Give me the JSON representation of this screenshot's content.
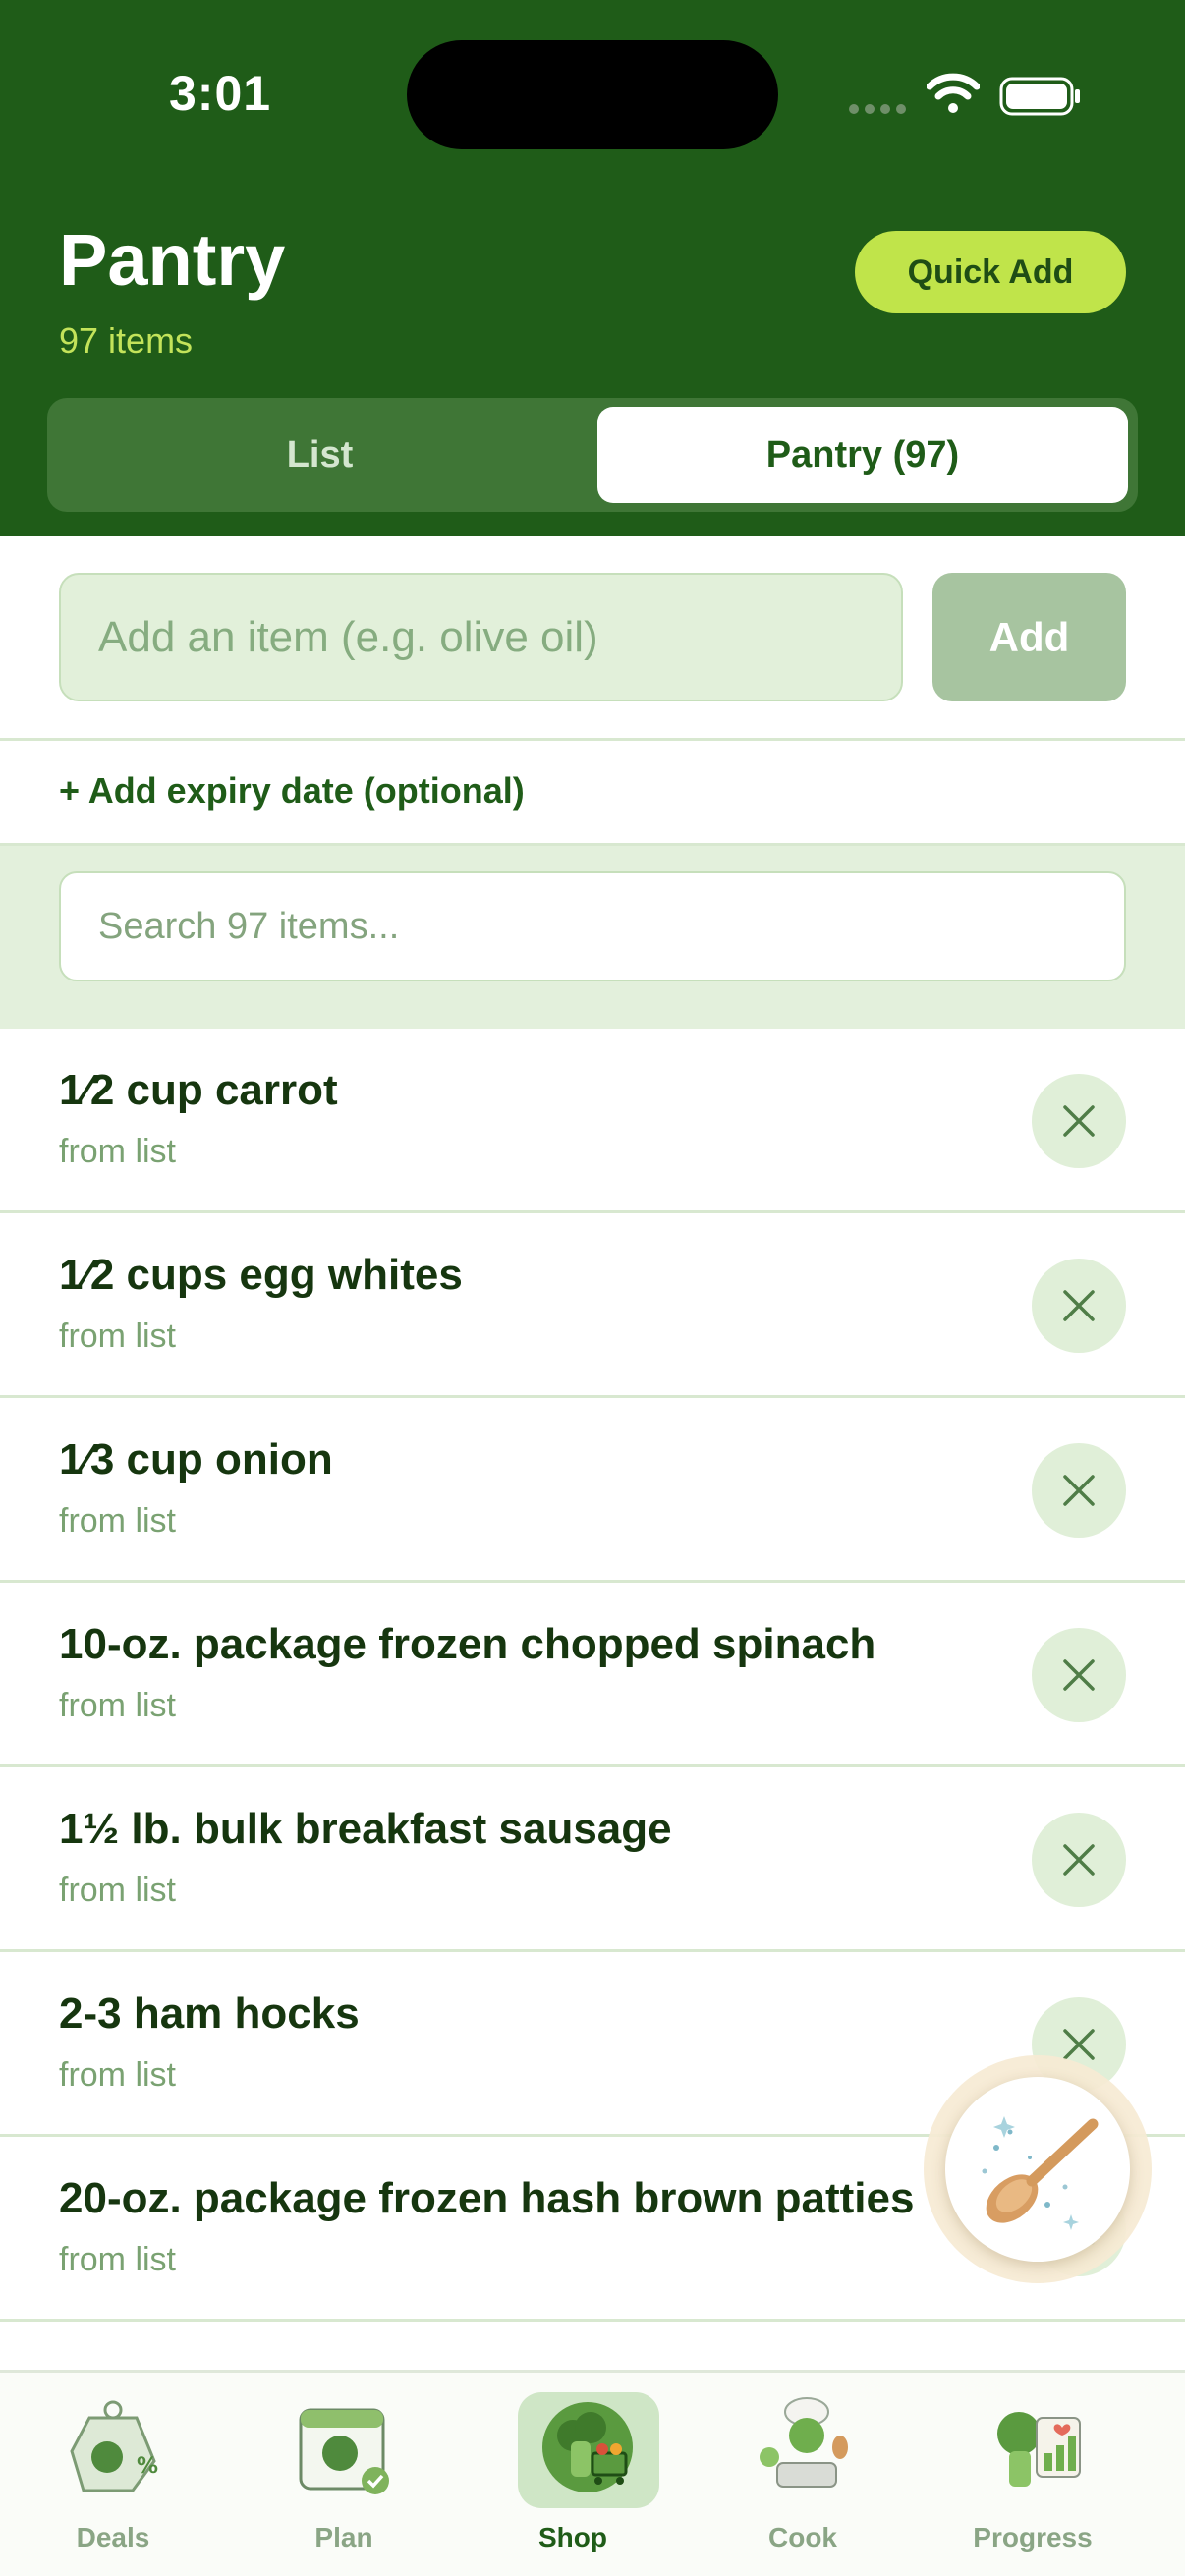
{
  "status_bar": {
    "time": "3:01"
  },
  "header": {
    "title": "Pantry",
    "count_label": "97 items",
    "quick_add_label": "Quick Add"
  },
  "segments": {
    "list_label": "List",
    "pantry_label": "Pantry (97)",
    "active": "pantry"
  },
  "add_form": {
    "placeholder": "Add an item (e.g. olive oil)",
    "button_label": "Add",
    "expiry_link": "+ Add expiry date (optional)"
  },
  "search": {
    "placeholder": "Search 97 items..."
  },
  "items": [
    {
      "name": "1⁄2 cup carrot",
      "source": "from list"
    },
    {
      "name": "1⁄2 cups egg whites",
      "source": "from list"
    },
    {
      "name": "1⁄3 cup onion",
      "source": "from list"
    },
    {
      "name": "10-oz. package frozen chopped spinach",
      "source": "from list"
    },
    {
      "name": "1½ lb. bulk breakfast sausage",
      "source": "from list"
    },
    {
      "name": "2-3 ham hocks",
      "source": "from list"
    },
    {
      "name": "20-oz. package frozen hash brown patties",
      "source": "from list"
    }
  ],
  "bottom_nav": [
    {
      "label": "Deals",
      "icon": "deals-tag-icon"
    },
    {
      "label": "Plan",
      "icon": "calendar-plan-icon"
    },
    {
      "label": "Shop",
      "icon": "shopping-cart-icon",
      "active": true
    },
    {
      "label": "Cook",
      "icon": "chef-cooking-icon"
    },
    {
      "label": "Progress",
      "icon": "progress-chart-icon"
    }
  ],
  "colors": {
    "header_bg": "#1f5c18",
    "accent": "#c0e44a",
    "light_green": "#e3f0dc"
  }
}
